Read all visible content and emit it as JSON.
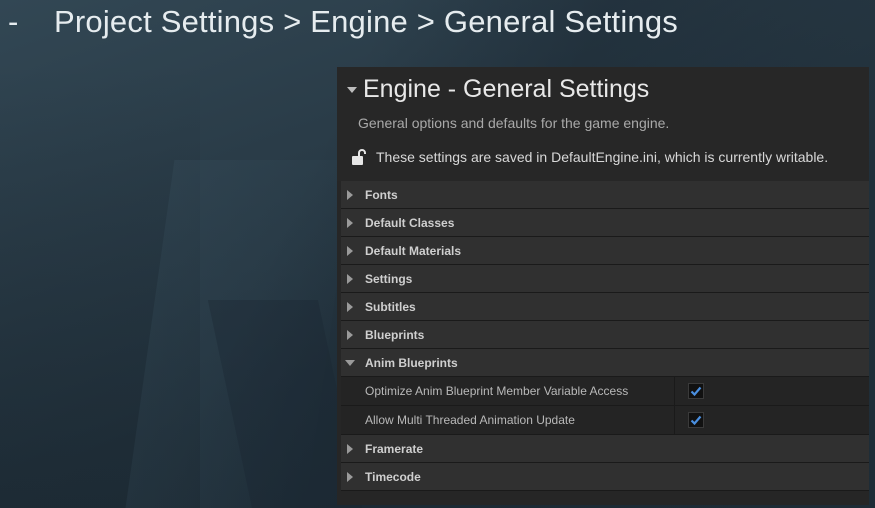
{
  "slide": {
    "dash": "-",
    "breadcrumb": "Project Settings > Engine > General Settings"
  },
  "panel": {
    "title": "Engine - General Settings",
    "description": "General options and defaults for the game engine.",
    "save_note": "These settings are saved in DefaultEngine.ini, which is currently writable.",
    "icons": {
      "lock": "unlocked-padlock-icon",
      "expand": "triangle-down-icon"
    }
  },
  "sections": [
    {
      "label": "Fonts",
      "expanded": false
    },
    {
      "label": "Default Classes",
      "expanded": false
    },
    {
      "label": "Default Materials",
      "expanded": false
    },
    {
      "label": "Settings",
      "expanded": false
    },
    {
      "label": "Subtitles",
      "expanded": false
    },
    {
      "label": "Blueprints",
      "expanded": false
    },
    {
      "label": "Anim Blueprints",
      "expanded": true,
      "properties": [
        {
          "label": "Optimize Anim Blueprint Member Variable Access",
          "checked": true
        },
        {
          "label": "Allow Multi Threaded Animation Update",
          "checked": true
        }
      ]
    },
    {
      "label": "Framerate",
      "expanded": false
    },
    {
      "label": "Timecode",
      "expanded": false
    }
  ],
  "colors": {
    "accent_check": "#4a8fe0",
    "panel_bg": "#262626",
    "row_bg": "#303030"
  }
}
